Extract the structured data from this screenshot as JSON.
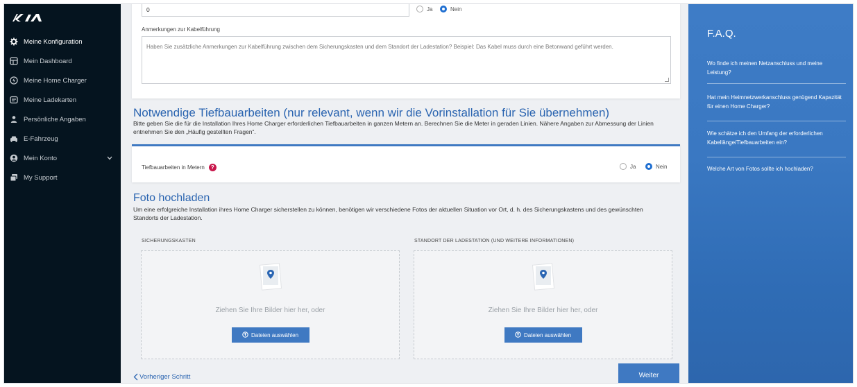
{
  "sidebar": {
    "items": [
      {
        "label": "Meine Konfiguration",
        "icon": "gear-icon"
      },
      {
        "label": "Mein Dashboard",
        "icon": "dashboard-icon"
      },
      {
        "label": "Meine Home Charger",
        "icon": "charger-icon"
      },
      {
        "label": "Meine Ladekarten",
        "icon": "card-icon"
      },
      {
        "label": "Persönliche Angaben",
        "icon": "person-icon"
      },
      {
        "label": "E-Fahrzeug",
        "icon": "car-icon"
      },
      {
        "label": "Mein Konto",
        "icon": "account-icon"
      },
      {
        "label": "My Support",
        "icon": "support-icon"
      }
    ]
  },
  "cable": {
    "number_value": "0",
    "radio_yes": "Ja",
    "radio_no": "Nein",
    "notes_label": "Anmerkungen zur Kabelführung",
    "notes_placeholder": "Haben Sie zusätzliche Anmerkungen zur Kabelführung zwischen dem Sicherungskasten und dem Standort der Ladestation? Beispiel: Das Kabel muss durch eine Betonwand geführt werden."
  },
  "earthworks": {
    "heading": "Notwendige Tiefbauarbeiten (nur relevant, wenn wir die Vorinstallation für Sie übernehmen)",
    "description": "Bitte geben Sie die für die Installation Ihres Home Charger erforderlichen Tiefbauarbeiten in ganzen Metern an. Berechnen Sie die Meter in geraden Linien. Nähere Angaben zur Abmessung der Linien entnehmen Sie den „Häufig gestellten Fragen“.",
    "field_label": "Tiefbauarbeiten in Metern",
    "radio_yes": "Ja",
    "radio_no": "Nein"
  },
  "upload": {
    "heading": "Foto hochladen",
    "description": "Um eine erfolgreiche Installation ihres Home Charger sicherstellen zu können, benötigen wir verschiedene Fotos der aktuellen Situation vor Ort, d. h. des Sicherungskastens und des gewünschten Standorts der Ladestation.",
    "zones": [
      {
        "title": "SICHERUNGSKASTEN",
        "text": "Ziehen Sie Ihre Bilder hier her, oder",
        "button": "Dateien auswählen"
      },
      {
        "title": "STANDORT DER LADESTATION (UND WEITERE INFORMATIONEN)",
        "text": "Ziehen Sie Ihre Bilder hier her, oder",
        "button": "Dateien auswählen"
      }
    ]
  },
  "footer": {
    "back": "Vorheriger Schritt",
    "next": "Weiter"
  },
  "faq": {
    "title": "F.A.Q.",
    "items": [
      "Wo finde ich meinen Netzanschluss und meine Leistung?",
      "Hat mein Heimnetzwerkanschluss genügend Kapazität für einen Home Charger?",
      "Wie schätze ich den Umfang der erforderlichen Kabellänge/Tiefbauarbeiten ein?",
      "Welche Art von Fotos sollte ich hochladen?"
    ]
  },
  "colors": {
    "sidebar_bg": "#05141f",
    "accent": "#2a64b0",
    "button": "#3f79c2",
    "help_badge": "#c8174b"
  }
}
